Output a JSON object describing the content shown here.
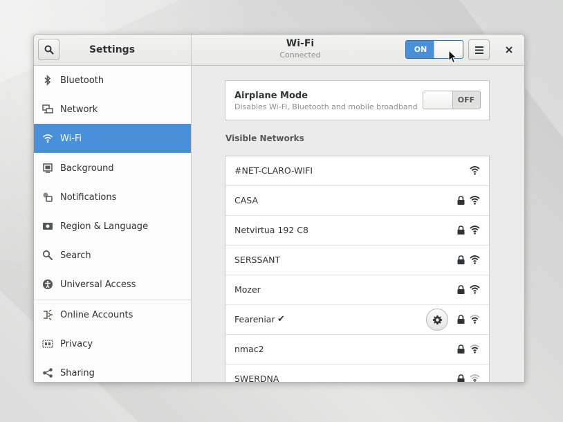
{
  "window": {
    "settings_title": "Settings",
    "panel_title": "Wi-Fi",
    "panel_subtitle": "Connected",
    "wifi_switch_label": "ON"
  },
  "sidebar": {
    "items": [
      {
        "label": "Bluetooth",
        "icon": "bluetooth-icon",
        "active": false
      },
      {
        "label": "Network",
        "icon": "network-icon",
        "active": false
      },
      {
        "label": "Wi-Fi",
        "icon": "wifi-icon",
        "active": true
      },
      {
        "label": "Background",
        "icon": "background-icon",
        "active": false
      },
      {
        "label": "Notifications",
        "icon": "notifications-icon",
        "active": false
      },
      {
        "label": "Region & Language",
        "icon": "region-icon",
        "active": false
      },
      {
        "label": "Search",
        "icon": "search-icon",
        "active": false
      },
      {
        "label": "Universal Access",
        "icon": "universal-access-icon",
        "active": false
      },
      {
        "label": "Online Accounts",
        "icon": "online-accounts-icon",
        "active": false
      },
      {
        "label": "Privacy",
        "icon": "privacy-icon",
        "active": false
      },
      {
        "label": "Sharing",
        "icon": "sharing-icon",
        "active": false
      }
    ]
  },
  "airplane": {
    "title": "Airplane Mode",
    "subtitle": "Disables Wi-Fi, Bluetooth and mobile broadband",
    "switch_label": "OFF"
  },
  "networks": {
    "heading": "Visible Networks",
    "items": [
      {
        "name": "#NET-CLARO-WIFI",
        "locked": false,
        "connected": false,
        "signal": "strong"
      },
      {
        "name": "CASA",
        "locked": true,
        "connected": false,
        "signal": "strong"
      },
      {
        "name": "Netvirtua 192 C8",
        "locked": true,
        "connected": false,
        "signal": "strong"
      },
      {
        "name": "SERSSANT",
        "locked": true,
        "connected": false,
        "signal": "strong"
      },
      {
        "name": "Mozer",
        "locked": true,
        "connected": false,
        "signal": "strong"
      },
      {
        "name": "Feareniar",
        "locked": true,
        "connected": true,
        "check": "✔",
        "signal": "medium"
      },
      {
        "name": "nmac2",
        "locked": true,
        "connected": false,
        "signal": "medium"
      },
      {
        "name": "SWERDNA",
        "locked": true,
        "connected": false,
        "signal": "weak"
      }
    ]
  },
  "colors": {
    "accent": "#4a90d9",
    "text": "#2e3436",
    "subtext": "#8c8e8b"
  }
}
